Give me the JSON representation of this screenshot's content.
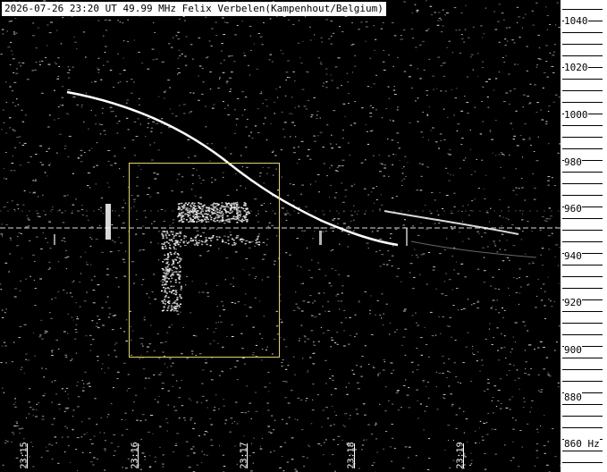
{
  "header": {
    "text": "2026-07-26 23:20 UT 49.99 MHz Felix Verbelen(Kampenhout/Belgium)"
  },
  "frequency_axis": {
    "labels": [
      "1040",
      "1020",
      "1000",
      "980",
      "960",
      "940",
      "920",
      "900",
      "880",
      "860 Hz"
    ],
    "unit": "Hz"
  },
  "time_axis": {
    "labels": [
      "23:15",
      "23:16",
      "23:17",
      "23:18",
      "23:19"
    ]
  },
  "colors": {
    "background": "#000000",
    "signal": "#ffffff",
    "selection": "#e6d84a"
  }
}
